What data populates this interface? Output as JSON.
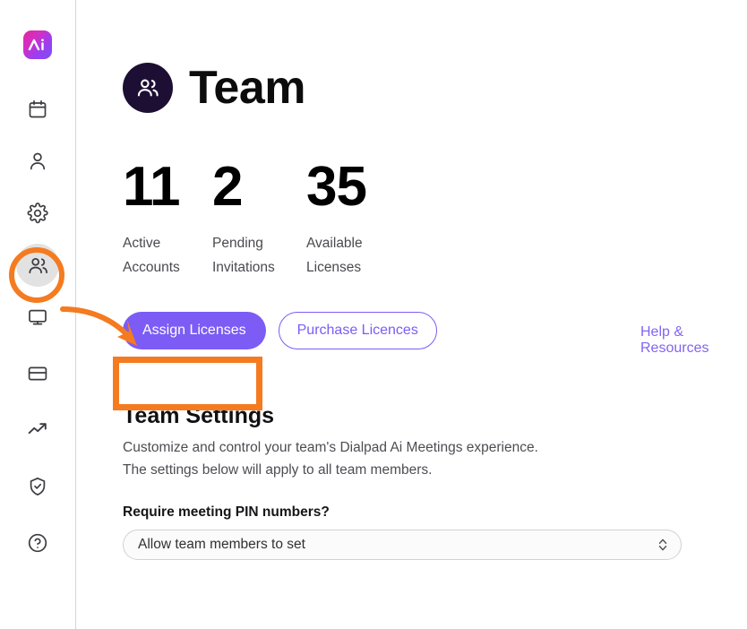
{
  "app": {
    "logo_name": "dialpad-ai-logo",
    "logo_text": "Ai",
    "accent_purple": "#7c5cf5",
    "annotation_orange": "#f47b20",
    "header_avatar_bg": "#1d0f33"
  },
  "sidebar": {
    "items": [
      {
        "icon": "calendar-icon",
        "label": "Calendar",
        "active": false
      },
      {
        "icon": "person-icon",
        "label": "Contacts",
        "active": false
      },
      {
        "icon": "gear-icon",
        "label": "Settings",
        "active": false
      },
      {
        "icon": "people-icon",
        "label": "Team",
        "active": true
      },
      {
        "icon": "monitor-icon",
        "label": "Devices",
        "active": false
      },
      {
        "icon": "credit-card-icon",
        "label": "Billing",
        "active": false
      },
      {
        "icon": "trending-up-icon",
        "label": "Analytics",
        "active": false
      },
      {
        "icon": "shield-check-icon",
        "label": "Security",
        "active": false
      },
      {
        "icon": "help-circle-icon",
        "label": "Help",
        "active": false
      }
    ]
  },
  "header": {
    "title": "Team",
    "avatar_icon": "people-icon"
  },
  "stats": [
    {
      "value": "11",
      "label": "Active\nAccounts",
      "label_line1": "Active",
      "label_line2": "Accounts"
    },
    {
      "value": "2",
      "label": "Pending\nInvitations",
      "label_line1": "Pending",
      "label_line2": "Invitations"
    },
    {
      "value": "35",
      "label": "Available\nLicenses",
      "label_line1": "Available",
      "label_line2": "Licenses"
    }
  ],
  "actions": {
    "assign_licenses_label": "Assign Licenses",
    "purchase_licences_label": "Purchase Licences",
    "help_resources_label": "Help & Resources"
  },
  "settings": {
    "title": "Team Settings",
    "description_line1": "Customize and control your team's Dialpad Ai Meetings experience.",
    "description_line2": "The settings below will apply to all team members.",
    "pin_field": {
      "label": "Require meeting PIN numbers?",
      "value": "Allow team members to set",
      "options": [
        "Allow team members to set"
      ]
    }
  }
}
